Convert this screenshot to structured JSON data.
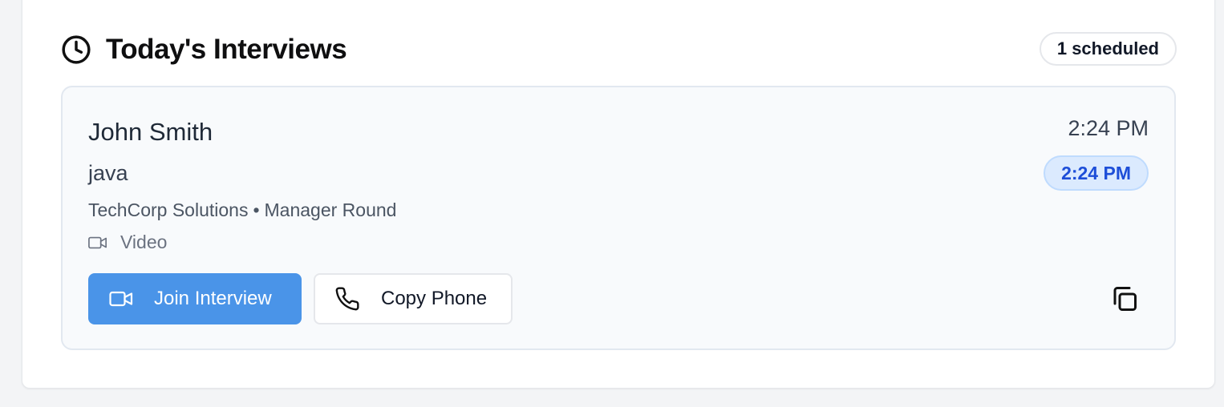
{
  "section": {
    "title": "Today's Interviews",
    "scheduled_badge": "1 scheduled",
    "icon": "clock-icon"
  },
  "interview": {
    "candidate_name": "John Smith",
    "role": "java",
    "company": "TechCorp Solutions",
    "separator": "•",
    "round": "Manager Round",
    "mode": "Video",
    "mode_icon": "video-icon",
    "time": "2:24 PM",
    "time_badge": "2:24 PM",
    "actions": {
      "join_label": "Join Interview",
      "join_icon": "video-icon",
      "copy_phone_label": "Copy Phone",
      "copy_phone_icon": "phone-icon",
      "copy_icon": "copy-icon"
    }
  },
  "colors": {
    "primary_button": "#4a94e8",
    "time_badge_bg": "#dbeafe",
    "time_badge_text": "#1d4ed8",
    "card_bg": "#f8fafc"
  }
}
